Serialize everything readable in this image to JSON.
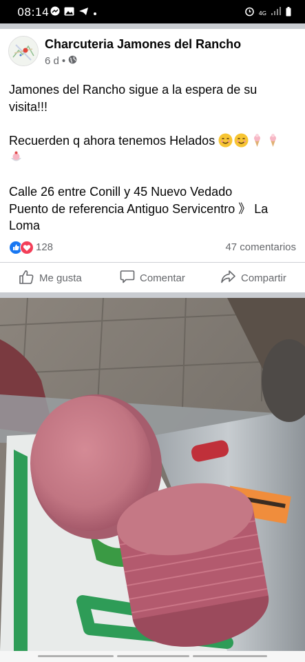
{
  "status_bar": {
    "time": "08:14",
    "network": "4G"
  },
  "post": {
    "page_name": "Charcuteria Jamones del Rancho",
    "time_ago": "6 d",
    "separator": "•",
    "text": {
      "line1": "Jamones del Rancho sigue a la espera de su visita!!!",
      "line2": "Recuerden q ahora tenemos Helados",
      "line3": "Calle 26 entre Conill y 45 Nuevo Vedado",
      "line4": "Puento de referencia Antiguo Servicentro 》 La Loma"
    },
    "reaction_count": "128",
    "comments_count": "47 comentarios"
  },
  "actions": {
    "like": "Me gusta",
    "comment": "Comentar",
    "share": "Compartir"
  },
  "icons": [
    "messenger-icon",
    "gallery-icon",
    "telegram-icon",
    "alarm-icon",
    "signal-icon",
    "globe-icon",
    "like-icon",
    "comment-icon",
    "share-icon",
    "like-reaction-icon",
    "love-reaction-icon"
  ],
  "colors": {
    "like_blue": "#1877f2",
    "love_red": "#f33e58",
    "secondary_text": "#65676b",
    "divider": "#c9ccd1"
  }
}
